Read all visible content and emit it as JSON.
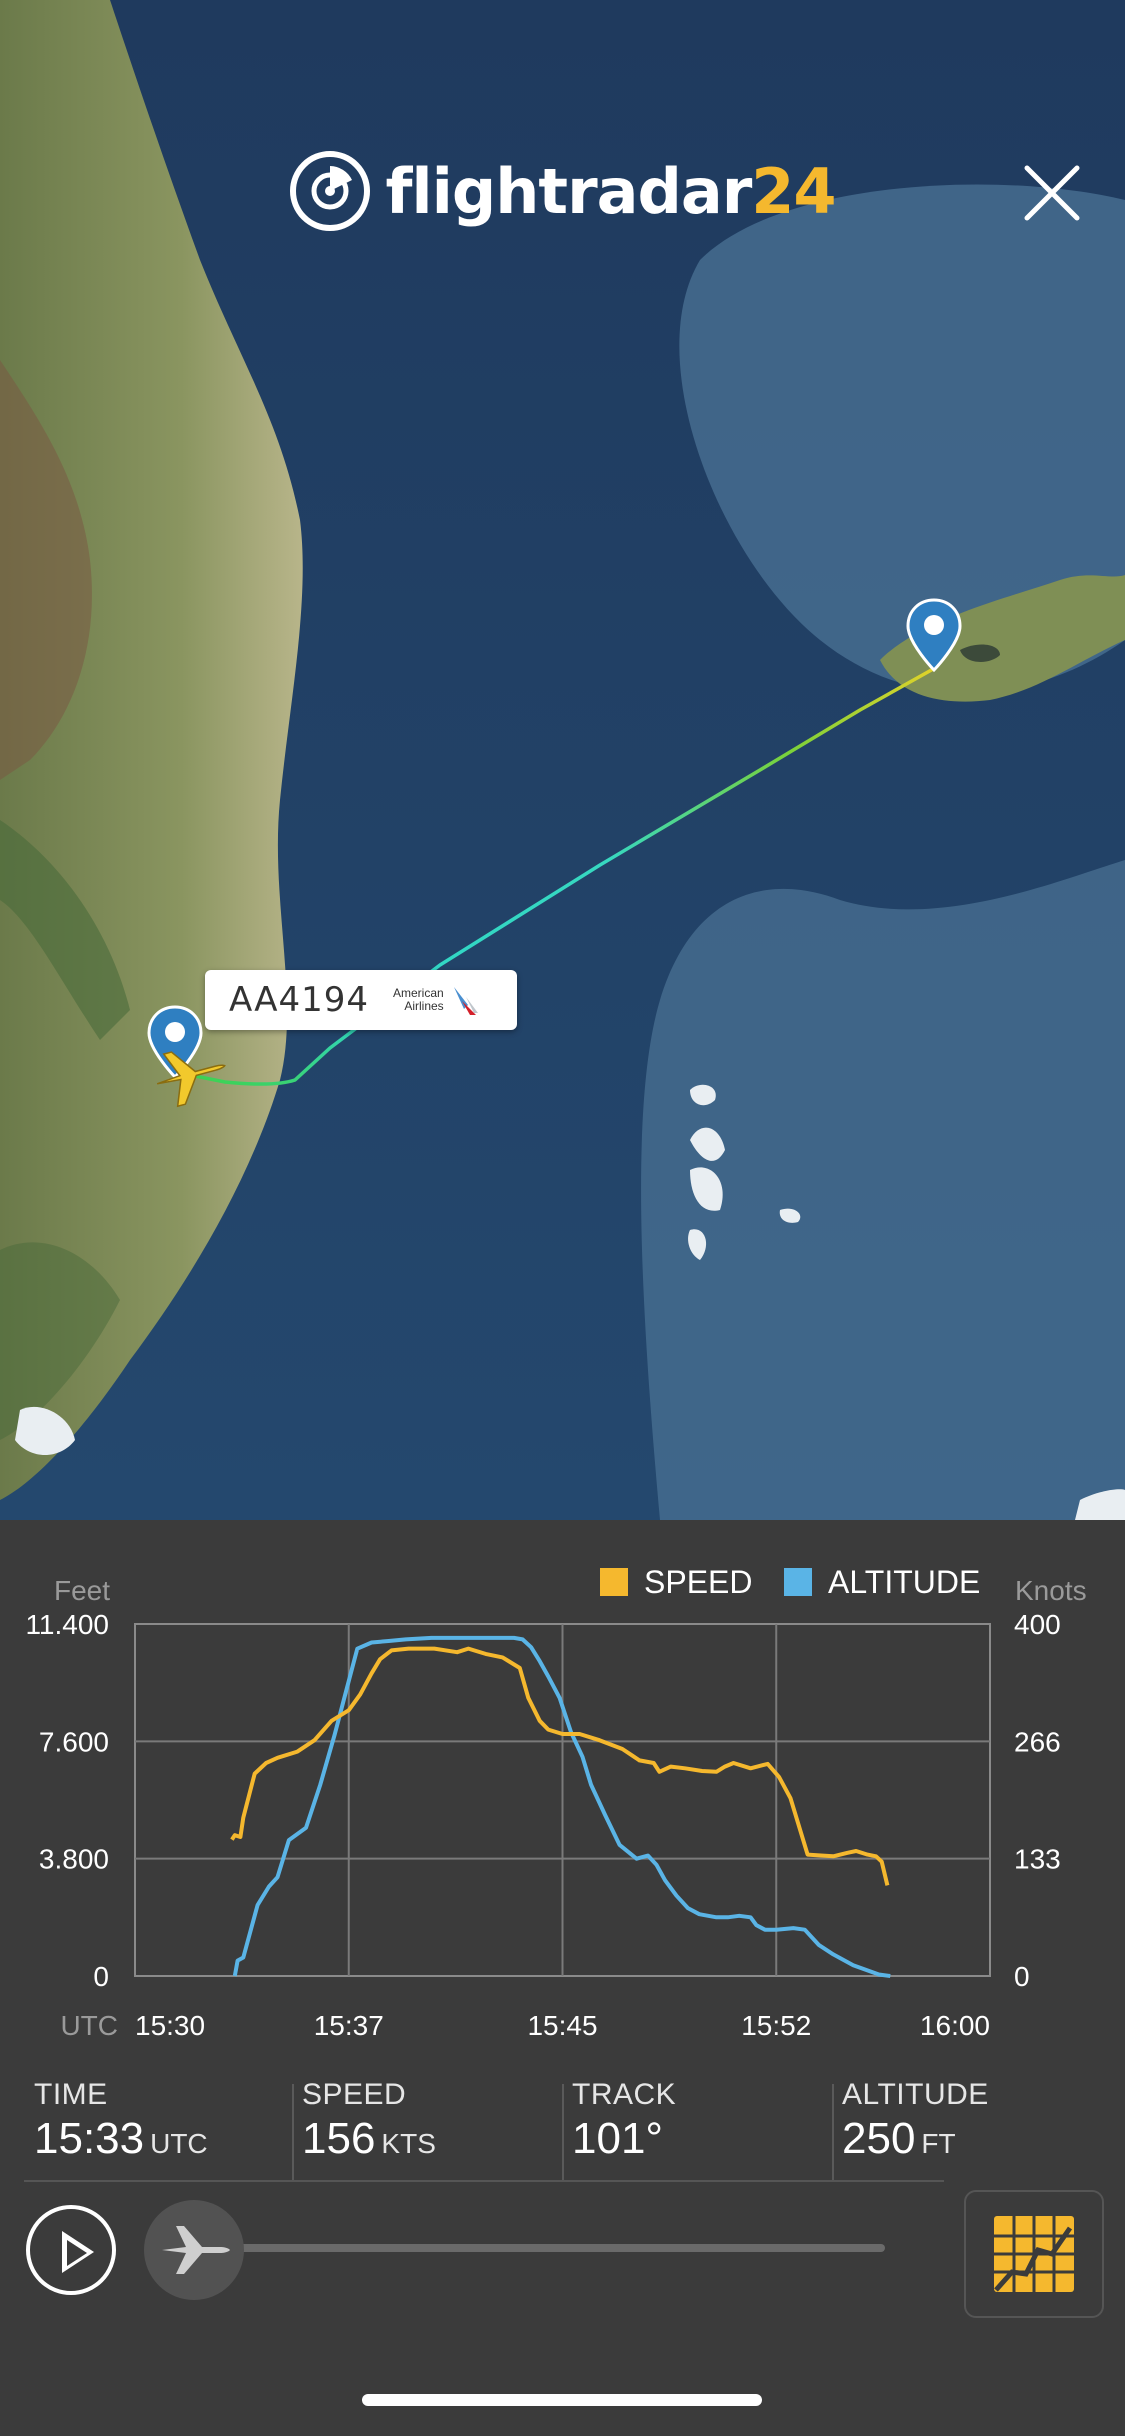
{
  "header": {
    "logo_text": "flightradar",
    "logo_number": "24"
  },
  "map": {
    "flight_label": "AA4194",
    "airline_line1": "American",
    "airline_line2": "Airlines"
  },
  "colors": {
    "accent": "#f5b82e",
    "speed": "#f5b82e",
    "altitude": "#5ab4e6",
    "panel_bg": "#3b3b3b",
    "pin": "#2f7fc1"
  },
  "chart_data": {
    "type": "line",
    "legend": [
      "SPEED",
      "ALTITUDE"
    ],
    "left_axis_title": "Feet",
    "right_axis_title": "Knots",
    "x_axis_title": "UTC",
    "left_ticks": [
      "11.400",
      "7.600",
      "3.800",
      "0"
    ],
    "right_ticks": [
      "400",
      "266",
      "133",
      "0"
    ],
    "x_ticks": [
      "15:30",
      "15:37",
      "15:45",
      "15:52",
      "16:00"
    ],
    "x_range_minutes": [
      0,
      30
    ],
    "altitude_ylim": [
      0,
      11400
    ],
    "speed_ylim": [
      0,
      400
    ],
    "series": [
      {
        "name": "ALTITUDE",
        "x": [
          3.5,
          3.6,
          3.8,
          4.3,
          4.7,
          5.0,
          5.4,
          6.0,
          6.5,
          7.0,
          7.4,
          7.8,
          8.3,
          8.9,
          9.5,
          10.4,
          11.2,
          12.2,
          12.8,
          13.3,
          13.6,
          13.9,
          14.2,
          14.5,
          14.9,
          15.3,
          15.7,
          16.0,
          16.5,
          17.0,
          17.6,
          18.0,
          18.3,
          18.6,
          19.0,
          19.4,
          19.8,
          20.4,
          20.8,
          21.2,
          21.6,
          21.8,
          22.1,
          22.5,
          23.1,
          23.5,
          24.0,
          24.5,
          25.2,
          26.1,
          26.5
        ],
        "values": [
          0,
          500,
          600,
          2300,
          2900,
          3200,
          4400,
          4800,
          6200,
          7800,
          9200,
          10600,
          10800,
          10850,
          10900,
          10950,
          10950,
          10950,
          10950,
          10950,
          10900,
          10650,
          10200,
          9700,
          9000,
          7900,
          7100,
          6200,
          5200,
          4250,
          3800,
          3900,
          3600,
          3100,
          2600,
          2200,
          2000,
          1900,
          1900,
          1950,
          1900,
          1650,
          1500,
          1500,
          1550,
          1500,
          1000,
          700,
          350,
          50,
          0
        ]
      },
      {
        "name": "SPEED",
        "x": [
          3.4,
          3.5,
          3.7,
          3.8,
          4.2,
          4.6,
          5.0,
          5.7,
          6.3,
          6.9,
          7.5,
          7.9,
          8.3,
          8.6,
          9.0,
          9.6,
          10.5,
          11.3,
          11.7,
          12.3,
          12.9,
          13.5,
          13.8,
          14.2,
          14.5,
          15.0,
          15.6,
          16.3,
          17.1,
          17.7,
          18.2,
          18.4,
          18.8,
          19.3,
          19.9,
          20.4,
          20.7,
          21.0,
          21.6,
          22.2,
          22.6,
          23.0,
          23.6,
          24.0,
          24.5,
          25.0,
          25.3,
          25.7,
          26.0,
          26.2,
          26.4
        ],
        "values": [
          155,
          160,
          158,
          180,
          230,
          242,
          248,
          255,
          268,
          290,
          302,
          320,
          344,
          360,
          370,
          372,
          372,
          368,
          372,
          366,
          362,
          350,
          316,
          290,
          280,
          275,
          275,
          268,
          258,
          245,
          242,
          232,
          238,
          236,
          233,
          232,
          238,
          242,
          236,
          241,
          226,
          202,
          138,
          137,
          136,
          140,
          142,
          138,
          136,
          130,
          103
        ]
      }
    ]
  },
  "info": {
    "time_label": "TIME",
    "time_value": "15:33",
    "time_unit": "UTC",
    "speed_label": "SPEED",
    "speed_value": "156",
    "speed_unit": "KTS",
    "track_label": "TRACK",
    "track_value": "101°",
    "altitude_label": "ALTITUDE",
    "altitude_value": "250",
    "altitude_unit": "FT",
    "playback_progress": 0
  }
}
